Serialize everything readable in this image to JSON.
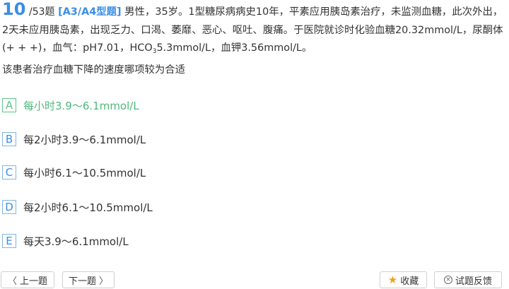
{
  "question": {
    "number": "10",
    "total": "/53题",
    "type": "[A3/A4型题]",
    "stem_line1": " 男性，35岁。1型糖尿病病史10年，平素应用胰岛素治疗，未监测血糖，此次外出，2天未应用胰岛素，出现乏力、口渴、萎靡、恶心、呕吐、腹痛。于医院就诊时化验血糖20.32mmol/L，尿酮体(+ + +)，血气：pH7.01，HCO",
    "stem_sub": "3",
    "stem_line2": "5.3mmol/L，血钾3.56mmol/L。",
    "prompt": "该患者治疗血糖下降的速度哪项较为合适"
  },
  "options": [
    {
      "letter": "A",
      "text": "每小时3.9～6.1mmol/L",
      "state": "correct"
    },
    {
      "letter": "B",
      "text": "每2小时3.9～6.1mmol/L",
      "state": "normal"
    },
    {
      "letter": "C",
      "text": "每小时6.1～10.5mmol/L",
      "state": "normal"
    },
    {
      "letter": "D",
      "text": "每2小时6.1～10.5mmol/L",
      "state": "normal"
    },
    {
      "letter": "E",
      "text": "每天3.9～6.1mmol/L",
      "state": "normal"
    }
  ],
  "footer": {
    "prev_label": "上一题",
    "next_label": "下一题",
    "favorite_label": "收藏",
    "feedback_label": "试题反馈"
  },
  "colors": {
    "accent": "#3a8ee6",
    "correct": "#4fb87c",
    "star": "#f0a020"
  }
}
